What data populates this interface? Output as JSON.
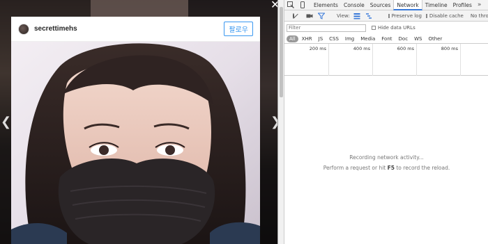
{
  "post": {
    "username": "secrettimehs",
    "follow_label": "팔로우"
  },
  "viewer_icons": {
    "prev": "chevron-left-icon",
    "next": "chevron-right-icon",
    "close": "close-icon"
  },
  "devtools": {
    "tabs": [
      {
        "label": "Elements",
        "active": false
      },
      {
        "label": "Console",
        "active": false
      },
      {
        "label": "Sources",
        "active": false
      },
      {
        "label": "Network",
        "active": true
      },
      {
        "label": "Timeline",
        "active": false
      },
      {
        "label": "Profiles",
        "active": false
      }
    ],
    "more_tabs": "»",
    "toolbar": {
      "view_label": "View:",
      "preserve_log": "Preserve log",
      "disable_cache": "Disable cache",
      "throttling": "No throttling"
    },
    "filter": {
      "placeholder": "Filter",
      "hide_data_urls": "Hide data URLs"
    },
    "types": [
      "All",
      "XHR",
      "JS",
      "CSS",
      "Img",
      "Media",
      "Font",
      "Doc",
      "WS",
      "Other"
    ],
    "timeline_ticks": [
      "200 ms",
      "400 ms",
      "600 ms",
      "800 ms"
    ],
    "empty_state": {
      "line1": "Recording network activity...",
      "line2_pre": "Perform a request or hit ",
      "line2_key": "F5",
      "line2_post": " to record the reload."
    },
    "colors": {
      "record": "#d93025",
      "accent": "#3879d9"
    }
  }
}
